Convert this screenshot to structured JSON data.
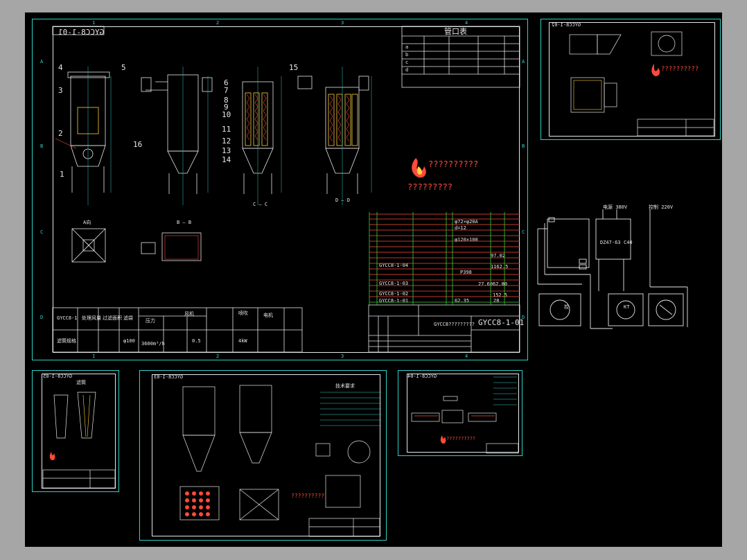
{
  "main_sheet": {
    "drawing_no_mirrored": "GYCC8-1-01",
    "zone_columns": [
      "1",
      "2",
      "3",
      "4"
    ],
    "zone_rows": [
      "A",
      "B",
      "C",
      "D"
    ],
    "nozzle_table": {
      "title": "管口表",
      "rows": [
        "a",
        "b",
        "c",
        "d"
      ]
    },
    "view_labels": {
      "a_view": "A向",
      "section_b": "B — B",
      "section_c": "C — C",
      "section_d": "D — D"
    },
    "balloons": [
      "1",
      "2",
      "3",
      "4",
      "5",
      "6",
      "7",
      "8",
      "9",
      "10",
      "11",
      "12",
      "13",
      "14",
      "15",
      "16"
    ],
    "logo_text": "??????????",
    "logo_caption": "?????????",
    "bom_marks": [
      "GYCC8-1-04",
      "GYCC8-1-03",
      "GYCC8-1-02",
      "GYCC8-1-01"
    ],
    "bom_values": [
      "φ72×φ20A",
      "d=12",
      "φ120×100",
      "97.02",
      "1162.5",
      "P398",
      "27.60",
      "62.80",
      "152.5",
      "62.35",
      "28"
    ],
    "title_block": {
      "name": "GYCC8?????????",
      "number": "GYCC8-1-01"
    },
    "spec_table": {
      "headers": [
        "GYCC8-1",
        "处理风量",
        "过滤面积",
        "滤袋",
        "压力",
        "风机",
        "喷吹",
        "电机"
      ],
      "values": [
        "滤筒规格",
        "φ100",
        "3600m³/h",
        "0.5",
        "4kW"
      ]
    }
  },
  "electrical": {
    "labels": [
      "电源 380V",
      "控制 220V",
      "DZ47-63",
      "C40"
    ],
    "dial_labels": [
      "控",
      "KT"
    ]
  },
  "thumbnails": {
    "top_right_no": "GYCC8-1-02",
    "bottom_left_no": "GYCC8-1-05",
    "bottom_left_title": "滤筒",
    "bottom_center_no": "GYCC8-1-03",
    "bottom_right_no": "GYCC8-1-04",
    "tech_title": "技术要求",
    "logo_text": "??????????"
  }
}
